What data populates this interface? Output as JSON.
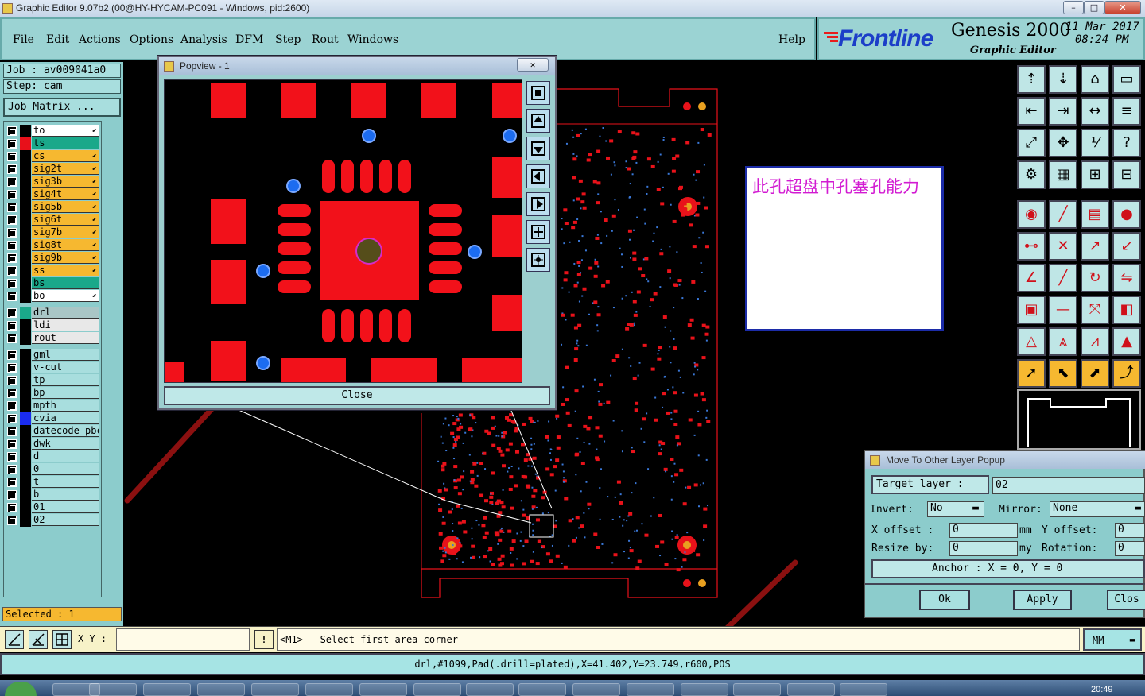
{
  "window": {
    "title": "Graphic Editor 9.07b2 (00@HY-HYCAM-PC091 - Windows, pid:2600)"
  },
  "menu": {
    "items": [
      "File",
      "Edit",
      "Actions",
      "Options",
      "Analysis",
      "DFM",
      "Step",
      "Rout",
      "Windows"
    ],
    "help": "Help"
  },
  "brand": {
    "logo": "Frontline",
    "product": "Genesis 2000",
    "subtitle": "Graphic Editor",
    "date": "11 Mar 2017",
    "time": "08:24 PM"
  },
  "job": {
    "job_label": "Job : av009041a0",
    "step_label": "Step: cam",
    "matrix_button": "Job Matrix ..."
  },
  "layers_group1": [
    {
      "name": "to",
      "color": "#ffffff",
      "swatch": "#000000",
      "edit": true
    },
    {
      "name": "ts",
      "color": "#1aa88a",
      "swatch": "#e8101a",
      "edit": false
    },
    {
      "name": "cs",
      "color": "#f6b830",
      "swatch": "#000000",
      "edit": true
    },
    {
      "name": "sig2t",
      "color": "#f6b830",
      "swatch": "#000000",
      "edit": true
    },
    {
      "name": "sig3b",
      "color": "#f6b830",
      "swatch": "#000000",
      "edit": true
    },
    {
      "name": "sig4t",
      "color": "#f6b830",
      "swatch": "#000000",
      "edit": true
    },
    {
      "name": "sig5b",
      "color": "#f6b830",
      "swatch": "#000000",
      "edit": true
    },
    {
      "name": "sig6t",
      "color": "#f6b830",
      "swatch": "#000000",
      "edit": true
    },
    {
      "name": "sig7b",
      "color": "#f6b830",
      "swatch": "#000000",
      "edit": true
    },
    {
      "name": "sig8t",
      "color": "#f6b830",
      "swatch": "#000000",
      "edit": true
    },
    {
      "name": "sig9b",
      "color": "#f6b830",
      "swatch": "#000000",
      "edit": true
    },
    {
      "name": "ss",
      "color": "#f6b830",
      "swatch": "#000000",
      "edit": true
    },
    {
      "name": "bs",
      "color": "#1aa88a",
      "swatch": "#000000",
      "edit": false
    },
    {
      "name": "bo",
      "color": "#ffffff",
      "swatch": "#000000",
      "edit": true
    }
  ],
  "layers_group2": [
    {
      "name": "drl",
      "color": "#a9c6c6",
      "swatch": "#1aa88a"
    },
    {
      "name": "ldi",
      "color": "#e8e8e8",
      "swatch": "#000000"
    },
    {
      "name": "rout",
      "color": "#e8e8e8",
      "swatch": "#000000"
    }
  ],
  "layers_group3": [
    {
      "name": "gml",
      "swatch": "#000000"
    },
    {
      "name": "v-cut",
      "swatch": "#000000"
    },
    {
      "name": "tp",
      "swatch": "#000000"
    },
    {
      "name": "bp",
      "swatch": "#000000"
    },
    {
      "name": "mpth",
      "swatch": "#000000"
    },
    {
      "name": "cvia",
      "swatch": "#1a2cf0"
    },
    {
      "name": "datecode-pbc",
      "swatch": "#000000"
    },
    {
      "name": "dwk",
      "swatch": "#000000"
    },
    {
      "name": "d",
      "swatch": "#000000"
    },
    {
      "name": "0",
      "swatch": "#000000"
    },
    {
      "name": "t",
      "swatch": "#000000"
    },
    {
      "name": "b",
      "swatch": "#000000"
    },
    {
      "name": "01",
      "swatch": "#000000"
    },
    {
      "name": "02",
      "swatch": "#000000"
    }
  ],
  "selected": "Selected : 1",
  "popview": {
    "title": "Popview - 1",
    "close": "Close"
  },
  "annotation": {
    "text": "此孔超盘中孔塞孔能力"
  },
  "movepopup": {
    "title": "Move To Other Layer Popup",
    "target_label": "Target layer :",
    "target_value": "02",
    "invert_label": "Invert:",
    "invert_value": "No",
    "mirror_label": "Mirror:",
    "mirror_value": "None",
    "xoffset_label": "X offset :",
    "xoffset_value": "0",
    "xoffset_unit": "mm",
    "yoffset_label": "Y offset:",
    "yoffset_value": "0",
    "resize_label": "Resize by:",
    "resize_value": "0",
    "resize_unit": "my",
    "rotation_label": "Rotation:",
    "rotation_value": "0",
    "anchor": "Anchor :   X = 0, Y = 0",
    "ok": "Ok",
    "apply": "Apply",
    "close": "Clos"
  },
  "cmd": {
    "xy_label": "X Y :",
    "xy_value": "",
    "prompt": "<M1> - Select first area corner",
    "units": "MM"
  },
  "status": {
    "text": "drl,#1099,Pad(.drill=plated),X=41.402,Y=23.749,r600,POS"
  },
  "taskbar": {
    "time": "20:49"
  },
  "colors": {
    "panel": "#8ccccc",
    "pad_red": "#f2111a",
    "via_blue": "#1c6cf0",
    "arrow": "#8b1010"
  }
}
